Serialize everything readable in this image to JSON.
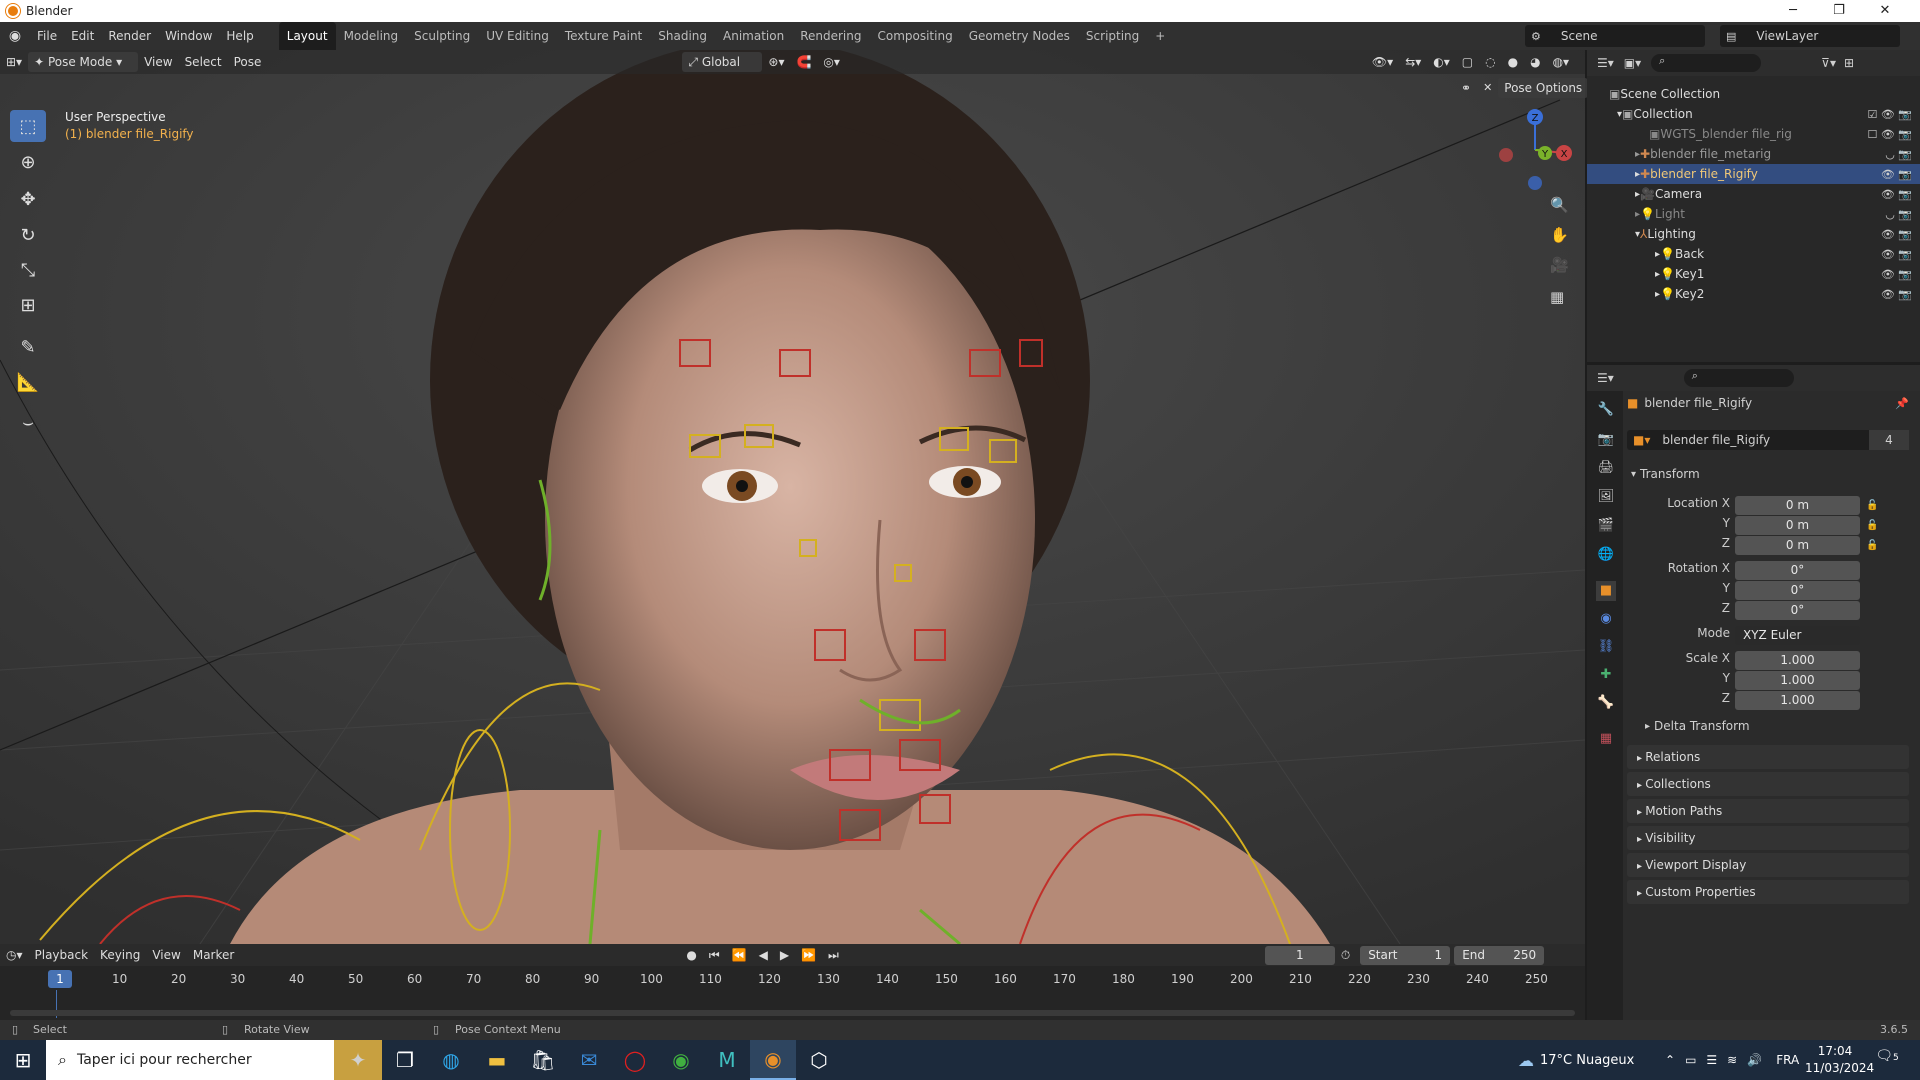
{
  "window": {
    "title": "Blender",
    "minimize": "─",
    "maximize": "❐",
    "close": "✕"
  },
  "menus": [
    "File",
    "Edit",
    "Render",
    "Window",
    "Help"
  ],
  "workspaces": [
    "Layout",
    "Modeling",
    "Sculpting",
    "UV Editing",
    "Texture Paint",
    "Shading",
    "Animation",
    "Rendering",
    "Compositing",
    "Geometry Nodes",
    "Scripting",
    "+"
  ],
  "scene": {
    "scene_name": "Scene",
    "view_layer": "ViewLayer"
  },
  "viewport": {
    "mode": "Pose Mode",
    "menus": [
      "View",
      "Select",
      "Pose"
    ],
    "orientation": "Global",
    "pose_options": "Pose Options",
    "overlay_line1": "User Perspective",
    "overlay_line2": "(1) blender file_Rigify",
    "gizmo": {
      "z": "Z",
      "y": "Y",
      "x": "X"
    }
  },
  "outliner": {
    "search_placeholder": "",
    "rows": [
      {
        "label": "Scene Collection",
        "indent": 0
      },
      {
        "label": "Collection",
        "indent": 1
      },
      {
        "label": "WGTS_blender file_rig",
        "indent": 2
      },
      {
        "label": "blender file_metarig",
        "indent": 2
      },
      {
        "label": "blender file_Rigify",
        "indent": 2
      },
      {
        "label": "Camera",
        "indent": 2
      },
      {
        "label": "Light",
        "indent": 2
      },
      {
        "label": "Lighting",
        "indent": 2
      },
      {
        "label": "Back",
        "indent": 3
      },
      {
        "label": "Key1",
        "indent": 3
      },
      {
        "label": "Key2",
        "indent": 3
      }
    ]
  },
  "properties": {
    "object_name": "blender file_Rigify",
    "data_name": "blender file_Rigify",
    "users": "4",
    "transform_label": "Transform",
    "location": {
      "label": "Location X",
      "x": "0 m",
      "y": "0 m",
      "z": "0 m"
    },
    "rotation": {
      "label": "Rotation X",
      "x": "0°",
      "y": "0°",
      "z": "0°"
    },
    "mode": {
      "label": "Mode",
      "value": "XYZ Euler"
    },
    "scale": {
      "label": "Scale X",
      "x": "1.000",
      "y": "1.000",
      "z": "1.000"
    },
    "axis_y": "Y",
    "axis_z": "Z",
    "panels": [
      "Delta Transform",
      "Relations",
      "Collections",
      "Motion Paths",
      "Visibility",
      "Viewport Display",
      "Custom Properties"
    ]
  },
  "timeline": {
    "menus": [
      "Playback",
      "Keying",
      "View",
      "Marker"
    ],
    "current_frame": "1",
    "start_label": "Start",
    "start": "1",
    "end_label": "End",
    "end": "250",
    "ticks": [
      "1",
      "10",
      "20",
      "30",
      "40",
      "50",
      "60",
      "70",
      "80",
      "90",
      "100",
      "110",
      "120",
      "130",
      "140",
      "150",
      "160",
      "170",
      "180",
      "190",
      "200",
      "210",
      "220",
      "230",
      "240",
      "250"
    ]
  },
  "status": {
    "select": "Select",
    "rotate": "Rotate View",
    "context": "Pose Context Menu",
    "version": "3.6.5"
  },
  "taskbar": {
    "search_placeholder": "Taper ici pour rechercher",
    "weather": "17°C  Nuageux",
    "lang": "FRA",
    "time": "17:04",
    "date": "11/03/2024",
    "notif": "5"
  },
  "colors": {
    "accent": "#4772b3",
    "selected_row": "#334d80",
    "bone_yellow": "#d4b020",
    "bone_red": "#c0302a",
    "bone_green": "#6fb02a"
  }
}
